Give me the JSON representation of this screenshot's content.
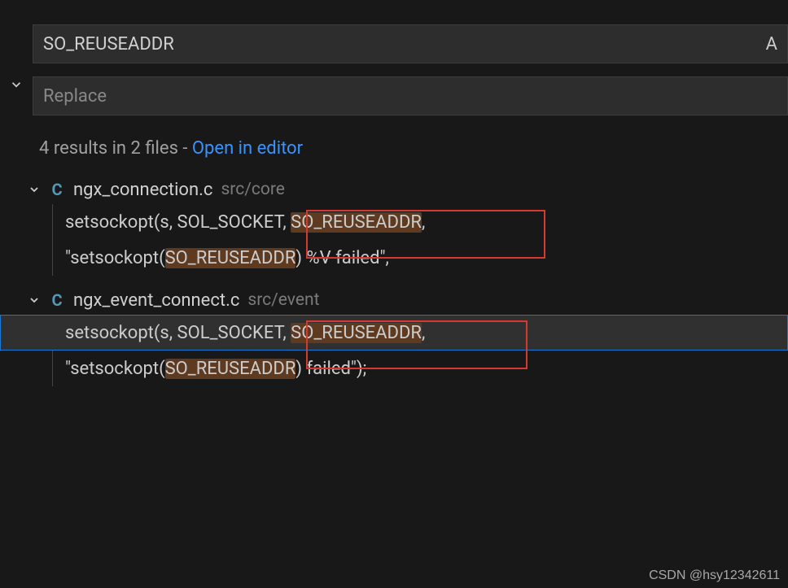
{
  "search": {
    "value": "SO_REUSEADDR",
    "right_icon": "A",
    "replace_placeholder": "Replace"
  },
  "summary": {
    "text": "4 results in 2 files - ",
    "link": "Open in editor"
  },
  "files": [
    {
      "icon": "C",
      "name": "ngx_connection.c",
      "path": "src/core",
      "results": [
        {
          "pre": "setsockopt(s, SOL_SOCKET, ",
          "match": "SO_REUSEADDR",
          "post": ",",
          "selected": false
        },
        {
          "pre": "\"setsockopt(",
          "match": "SO_REUSEADDR",
          "post": ") %V failed\",",
          "selected": false
        }
      ]
    },
    {
      "icon": "C",
      "name": "ngx_event_connect.c",
      "path": "src/event",
      "results": [
        {
          "pre": "setsockopt(s, SOL_SOCKET, ",
          "match": "SO_REUSEADDR",
          "post": ",",
          "selected": true
        },
        {
          "pre": "\"setsockopt(",
          "match": "SO_REUSEADDR",
          "post": ") failed\");",
          "selected": false
        }
      ]
    }
  ],
  "watermark": "CSDN @hsy12342611"
}
